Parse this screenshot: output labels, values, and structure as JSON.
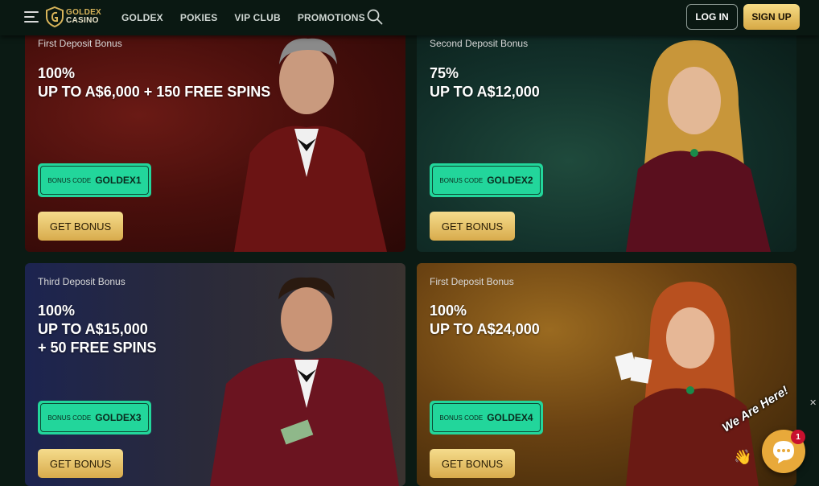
{
  "header": {
    "logo_line1": "GOLDEX",
    "logo_line2": "CASINO",
    "nav": [
      "GOLDEX",
      "POKIES",
      "VIP CLUB",
      "PROMOTIONS"
    ],
    "login_label": "LOG IN",
    "signup_label": "SIGN UP"
  },
  "cards": [
    {
      "subtitle": "First Deposit Bonus",
      "line1": "100%",
      "line2": "UP TO A$6,000 + 150 FREE SPINS",
      "line3": "",
      "code_label": "BONUS CODE",
      "code": "GOLDEX1",
      "button": "GET BONUS"
    },
    {
      "subtitle": "Second Deposit Bonus",
      "line1": "75%",
      "line2": "UP TO A$12,000",
      "line3": "",
      "code_label": "BONUS CODE",
      "code": "GOLDEX2",
      "button": "GET BONUS"
    },
    {
      "subtitle": "Third Deposit Bonus",
      "line1": "100%",
      "line2": "UP TO A$15,000",
      "line3": "+ 50 FREE SPINS",
      "code_label": "BONUS CODE",
      "code": "GOLDEX3",
      "button": "GET BONUS"
    },
    {
      "subtitle": "First Deposit Bonus",
      "line1": "100%",
      "line2": "UP TO A$24,000",
      "line3": "",
      "code_label": "BONUS CODE",
      "code": "GOLDEX4",
      "button": "GET BONUS"
    }
  ],
  "chat": {
    "tagline": "We Are Here!",
    "badge": "1",
    "wave": "👋"
  },
  "colors": {
    "accent_gold": "#d8ab4c",
    "code_green": "#22d69b",
    "header_bg": "#0a1812"
  }
}
